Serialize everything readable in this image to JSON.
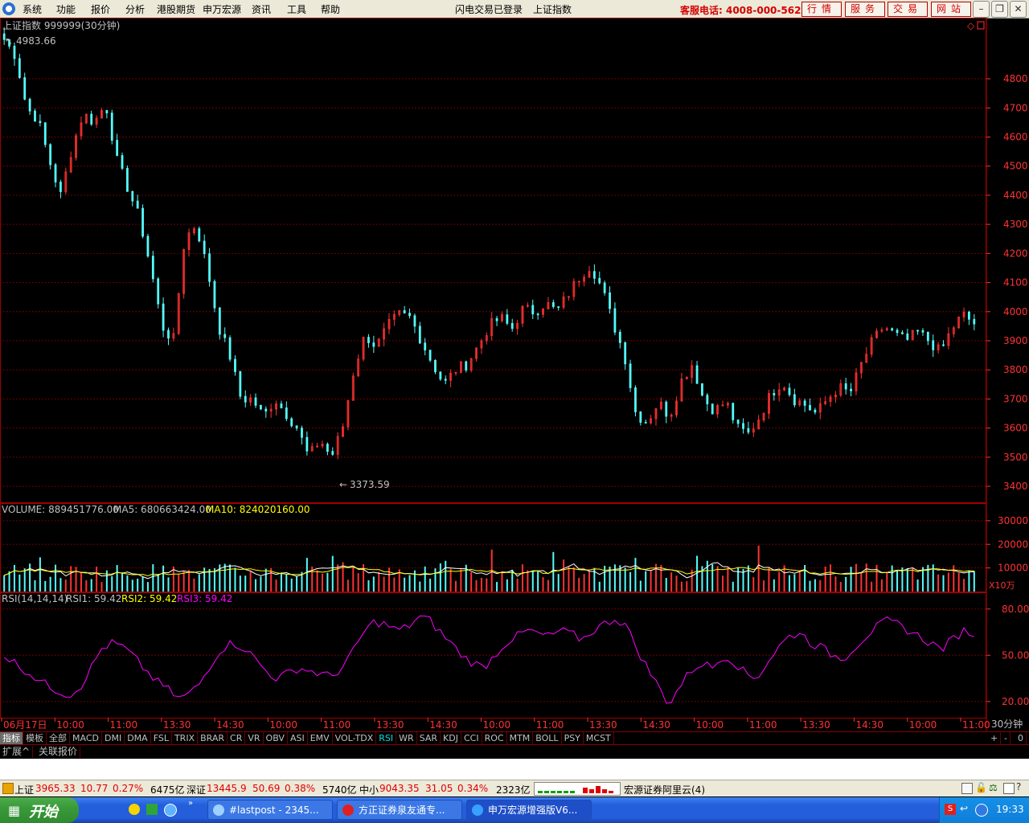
{
  "menubar": {
    "items": [
      "系统",
      "功能",
      "报价",
      "分析",
      "港股期货",
      "申万宏源",
      "资讯",
      "工具",
      "帮助"
    ],
    "login_status": "闪电交易已登录",
    "current_index": "上证指数",
    "hotline": "客服电话: 4008-000-562",
    "right_buttons": [
      "行情",
      "服务",
      "交易",
      "网站"
    ],
    "window_buttons": [
      "minimize",
      "restore",
      "close"
    ]
  },
  "chart_header": {
    "title": "上证指数 999999(30分钟)",
    "high_marker": "4983.66",
    "low_marker": "3373.59"
  },
  "volume_header": {
    "volume_label": "VOLUME: 889451776.00",
    "ma5_label": "MA5: 680663424.00",
    "ma10_label": "MA10: 824020160.00",
    "unit": "X10万"
  },
  "rsi_header": {
    "rsi_label": "RSI(14,14,14)",
    "rsi1": "RSI1: 59.42",
    "rsi2": "RSI2: 59.42",
    "rsi3": "RSI3: 59.42"
  },
  "colors": {
    "up": "#ff3232",
    "down": "#54fcfc",
    "grid": "#700000",
    "axis": "#ff3232",
    "ma5": "#ffffff",
    "ma10": "#ffff00",
    "rsi": "#ff00ff"
  },
  "chart_data": [
    {
      "type": "candlestick",
      "title": "上证指数 999999(30分钟)",
      "y_ticks": [
        3400,
        3500,
        3600,
        3700,
        3800,
        3900,
        4000,
        4100,
        4200,
        4300,
        4400,
        4500,
        4600,
        4700,
        4800
      ],
      "ylim": [
        3345,
        5010
      ],
      "grid": true,
      "series_shape": [
        [
          4935,
          0
        ],
        [
          4880,
          -1
        ],
        [
          4700,
          -1
        ],
        [
          4660,
          -1
        ],
        [
          4520,
          -1
        ],
        [
          4400,
          -1
        ],
        [
          4560,
          1
        ],
        [
          4680,
          1
        ],
        [
          4650,
          0
        ],
        [
          4715,
          1
        ],
        [
          4520,
          -1
        ],
        [
          4420,
          -1
        ],
        [
          4320,
          -1
        ],
        [
          4150,
          -1
        ],
        [
          3950,
          -1
        ],
        [
          3900,
          -1
        ],
        [
          4250,
          1
        ],
        [
          4300,
          1
        ],
        [
          4150,
          -1
        ],
        [
          3950,
          -1
        ],
        [
          3850,
          -1
        ],
        [
          3700,
          -1
        ],
        [
          3700,
          0
        ],
        [
          3640,
          -1
        ],
        [
          3700,
          1
        ],
        [
          3650,
          -1
        ],
        [
          3600,
          -1
        ],
        [
          3500,
          -1
        ],
        [
          3560,
          1
        ],
        [
          3500,
          -1
        ],
        [
          3600,
          1
        ],
        [
          3800,
          1
        ],
        [
          3920,
          1
        ],
        [
          3880,
          -1
        ],
        [
          3950,
          1
        ],
        [
          3990,
          1
        ],
        [
          3980,
          -1
        ],
        [
          3900,
          -1
        ],
        [
          3820,
          -1
        ],
        [
          3750,
          -1
        ],
        [
          3800,
          1
        ],
        [
          3820,
          1
        ],
        [
          3880,
          1
        ],
        [
          3950,
          1
        ],
        [
          3980,
          1
        ],
        [
          3940,
          -1
        ],
        [
          4010,
          1
        ],
        [
          4000,
          -1
        ],
        [
          4030,
          1
        ],
        [
          4000,
          -1
        ],
        [
          4060,
          1
        ],
        [
          4120,
          1
        ],
        [
          4160,
          1
        ],
        [
          4080,
          -1
        ],
        [
          3960,
          -1
        ],
        [
          3850,
          -1
        ],
        [
          3650,
          -1
        ],
        [
          3620,
          -1
        ],
        [
          3690,
          1
        ],
        [
          3640,
          -1
        ],
        [
          3760,
          1
        ],
        [
          3820,
          1
        ],
        [
          3700,
          -1
        ],
        [
          3660,
          -1
        ],
        [
          3690,
          1
        ],
        [
          3600,
          -1
        ],
        [
          3580,
          -1
        ],
        [
          3640,
          1
        ],
        [
          3720,
          1
        ],
        [
          3760,
          1
        ],
        [
          3700,
          -1
        ],
        [
          3680,
          -1
        ],
        [
          3650,
          -1
        ],
        [
          3700,
          1
        ],
        [
          3740,
          1
        ],
        [
          3720,
          -1
        ],
        [
          3820,
          1
        ],
        [
          3900,
          1
        ],
        [
          3950,
          1
        ],
        [
          3920,
          -1
        ],
        [
          3900,
          -1
        ],
        [
          3930,
          1
        ],
        [
          3900,
          -1
        ],
        [
          3860,
          -1
        ],
        [
          3940,
          1
        ],
        [
          3990,
          1
        ],
        [
          3960,
          -1
        ]
      ],
      "x_ticks": [
        "06月17日",
        "10:00",
        "11:00",
        "13:30",
        "14:30",
        "10:00",
        "11:00",
        "13:30",
        "14:30",
        "10:00",
        "11:00",
        "13:30",
        "14:30",
        "10:00",
        "11:00",
        "13:30",
        "14:30",
        "10:00",
        "11:00"
      ],
      "annotations": [
        "4983.66",
        "3373.59"
      ]
    },
    {
      "type": "bar",
      "title": "VOLUME",
      "y_ticks": [
        10000,
        20000,
        30000
      ],
      "ylim": [
        0,
        32000
      ],
      "series": [
        {
          "name": "MA5"
        },
        {
          "name": "MA10"
        }
      ]
    },
    {
      "type": "line",
      "title": "RSI(14,14,14)",
      "y_ticks": [
        20.0,
        50.0,
        80.0
      ],
      "ylim": [
        10,
        83
      ],
      "values": [
        50,
        45,
        40,
        35,
        30,
        27,
        24,
        30,
        42,
        55,
        58,
        55,
        48,
        40,
        33,
        28,
        22,
        25,
        32,
        45,
        55,
        58,
        55,
        48,
        40,
        35,
        38,
        42,
        40,
        38,
        36,
        42,
        52,
        65,
        72,
        70,
        66,
        68,
        75,
        73,
        65,
        58,
        50,
        45,
        42,
        50,
        58,
        62,
        66,
        64,
        62,
        66,
        64,
        60,
        66,
        70,
        74,
        70,
        55,
        42,
        30,
        18,
        30,
        40,
        45,
        42,
        50,
        46,
        38,
        35,
        45,
        55,
        62,
        65,
        58,
        55,
        50,
        48,
        55,
        62,
        68,
        72,
        70,
        66,
        62,
        58,
        54,
        60,
        66,
        64
      ]
    },
    {
      "type": "axis",
      "x_ticks": [
        "06月17日",
        "10:00",
        "11:00",
        "13:30",
        "14:30",
        "10:00",
        "11:00",
        "13:30",
        "14:30",
        "10:00",
        "11:00",
        "13:30",
        "14:30",
        "10:00",
        "11:00",
        "13:30",
        "14:30",
        "10:00",
        "11:00"
      ],
      "period_label": "30分钟"
    }
  ],
  "indicator_tabs": [
    "指标",
    "模板",
    "全部",
    "MACD",
    "DMI",
    "DMA",
    "FSL",
    "TRIX",
    "BRAR",
    "CR",
    "VR",
    "OBV",
    "ASI",
    "EMV",
    "VOL-TDX",
    "RSI",
    "WR",
    "SAR",
    "KDJ",
    "CCI",
    "ROC",
    "MTM",
    "BOLL",
    "PSY",
    "MCST"
  ],
  "tab_controls": [
    "+",
    "-",
    "0"
  ],
  "ext_tabs": [
    "扩展^",
    "关联报价"
  ],
  "status": {
    "sh_label": "上证",
    "sh_value": "3965.33",
    "sh_change": "10.77",
    "sh_pct": "0.27%",
    "sh_amount": "6475亿",
    "sz_label": "深证",
    "sz_value": "13445.9",
    "sz_change": "50.69",
    "sz_pct": "0.38%",
    "sz_amount": "5740亿",
    "zx_label": "中小",
    "zx_value": "9043.35",
    "zx_change": "31.05",
    "zx_pct": "0.34%",
    "zx_amount": "2323亿",
    "server": "宏源证券阿里云(4)"
  },
  "taskbar": {
    "start_label": "开始",
    "tasks": [
      "#lastpost - 2345...",
      "方正证券泉友通专...",
      "申万宏源增强版V6..."
    ],
    "clock": "19:33"
  }
}
